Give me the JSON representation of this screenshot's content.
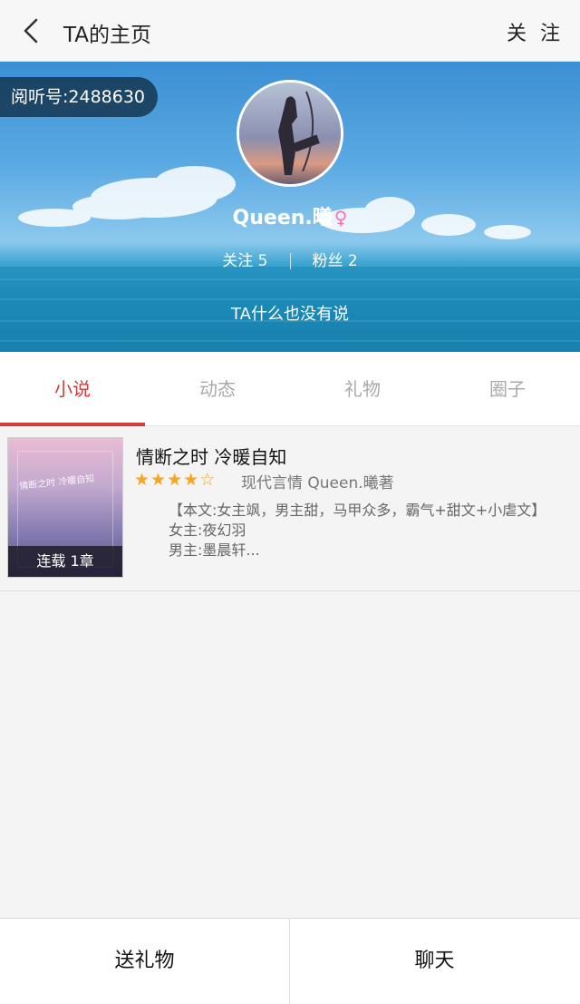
{
  "nav": {
    "title": "TA的主页",
    "follow_label": "关 注"
  },
  "profile": {
    "read_id": "阅听号:2488630",
    "username": "Queen.曦",
    "gender_symbol": "♀",
    "following_label": "关注",
    "following_count": "5",
    "followers_label": "粉丝",
    "followers_count": "2",
    "bio": "TA什么也没有说"
  },
  "tabs": [
    {
      "label": "小说",
      "active": true
    },
    {
      "label": "动态",
      "active": false
    },
    {
      "label": "礼物",
      "active": false
    },
    {
      "label": "圈子",
      "active": false
    }
  ],
  "books": [
    {
      "title": "情断之时  冷暖自知",
      "rating": 4,
      "rating_max": 5,
      "category": "现代言情",
      "author_line": "Queen.曦著",
      "cover_script": "情断之时 冷暖自知",
      "status_badge": "连载 1章",
      "desc_line1": "【本文:女主飒，男主甜，马甲众多，霸气+甜文+小虐文】",
      "desc_line2": "女主:夜幻羽",
      "desc_line3": "男主:墨晨轩..."
    }
  ],
  "bottom": {
    "gift_label": "送礼物",
    "chat_label": "聊天"
  },
  "colors": {
    "accent": "#d63b3b",
    "star": "#f5a623",
    "gender": "#ff6fb7"
  }
}
